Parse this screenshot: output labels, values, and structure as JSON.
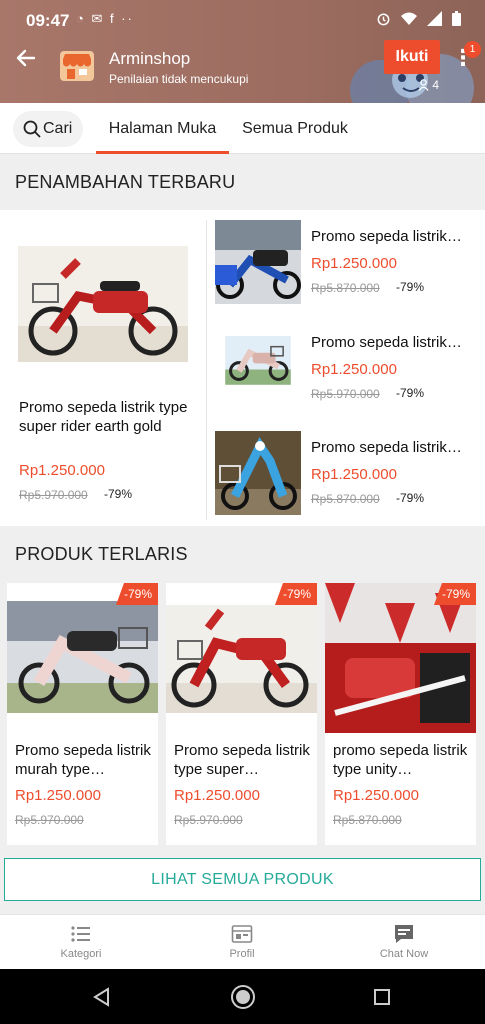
{
  "status_bar": {
    "time": "09:47",
    "left_icons": "◔ ✉ f ··",
    "right_icons": [
      "alarm-icon",
      "wifi-icon",
      "signal-icon",
      "battery-icon"
    ]
  },
  "header": {
    "shop_name": "Arminshop",
    "rating_text": "Penilaian tidak mencukupi",
    "follow_label": "Ikuti",
    "follower_count": "4",
    "notification_count": "1"
  },
  "tabs": {
    "search_label": "Cari",
    "home": "Halaman Muka",
    "all_products": "Semua Produk"
  },
  "recent": {
    "heading": "PENAMBAHAN TERBARU",
    "featured": {
      "title": "Promo sepeda listrik type super rider earth gold",
      "price": "Rp1.250.000",
      "old_price": "Rp5.970.000",
      "discount": "-79%"
    },
    "items": [
      {
        "title": "Promo sepeda listrik…",
        "price": "Rp1.250.000",
        "old_price": "Rp5.870.000",
        "discount": "-79%"
      },
      {
        "title": "Promo sepeda listrik…",
        "price": "Rp1.250.000",
        "old_price": "Rp5.970.000",
        "discount": "-79%"
      },
      {
        "title": "Promo sepeda listrik…",
        "price": "Rp1.250.000",
        "old_price": "Rp5.870.000",
        "discount": "-79%"
      }
    ]
  },
  "bestsellers": {
    "heading": "PRODUK TERLARIS",
    "items": [
      {
        "title": "Promo sepeda listrik murah type…",
        "price": "Rp1.250.000",
        "old_price": "Rp5.970.000",
        "discount": "-79%"
      },
      {
        "title": "Promo sepeda listrik type super…",
        "price": "Rp1.250.000",
        "old_price": "Rp5.970.000",
        "discount": "-79%"
      },
      {
        "title": "promo sepeda listrik type unity…",
        "price": "Rp1.250.000",
        "old_price": "Rp5.870.000",
        "discount": "-79%"
      }
    ],
    "see_all_label": "LIHAT SEMUA PRODUK"
  },
  "bottom_nav": {
    "categories": "Kategori",
    "profile": "Profil",
    "chat": "Chat Now"
  },
  "colors": {
    "accent": "#ee4d2d",
    "teal": "#26aa99",
    "header_bg": "#a8776a"
  }
}
